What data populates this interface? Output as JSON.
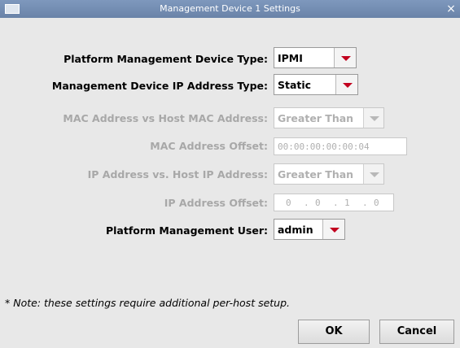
{
  "window": {
    "title": "Management Device 1 Settings",
    "close_glyph": "×",
    "icon": "window-icon"
  },
  "form": {
    "device_type": {
      "label": "Platform Management Device Type:",
      "value": "IPMI",
      "enabled": true
    },
    "ip_type": {
      "label": "Management Device IP Address Type:",
      "value": "Static",
      "enabled": true
    },
    "mac_compare": {
      "label": "MAC Address vs Host MAC Address:",
      "value": "Greater Than",
      "enabled": false
    },
    "mac_offset": {
      "label": "MAC Address Offset:",
      "value": "00:00:00:00:00:04",
      "enabled": false
    },
    "ip_compare": {
      "label": "IP Address vs. Host IP Address:",
      "value": "Greater Than",
      "enabled": false
    },
    "ip_offset": {
      "label": "IP Address Offset:",
      "octets": [
        "0",
        "0",
        "1",
        "0"
      ],
      "separator": ".",
      "enabled": false
    },
    "user": {
      "label": "Platform Management User:",
      "value": "admin",
      "enabled": true
    }
  },
  "note": "* Note: these settings require additional per-host setup.",
  "buttons": {
    "ok": "OK",
    "cancel": "Cancel"
  },
  "colors": {
    "titlebar": "#7088ad",
    "accent_arrow": "#c2001e",
    "background": "#e8e8e8",
    "disabled_text": "#a8a8a8"
  }
}
